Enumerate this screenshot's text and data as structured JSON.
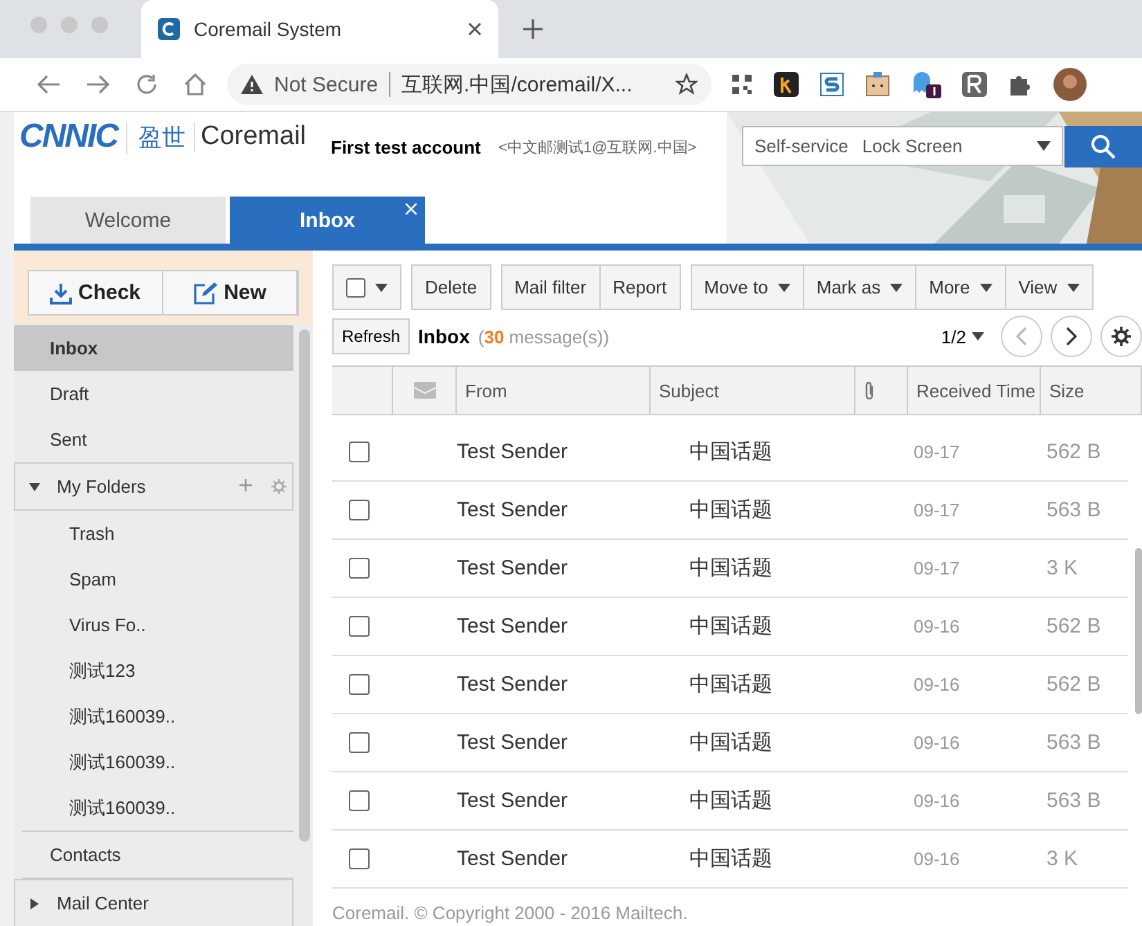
{
  "browser": {
    "tab_title": "Coremail System",
    "security": "Not Secure",
    "url": "互联网.中国/coremail/X..."
  },
  "header": {
    "logo": "CNNIC",
    "brand_cn": "盈世",
    "brand": "Coremail",
    "account_name": "First test account",
    "account_email": "<中文邮测试1@互联网.中国>",
    "links": [
      "Self-service",
      "Lock Screen"
    ]
  },
  "tabs": [
    {
      "label": "Welcome",
      "selected": false,
      "closable": false
    },
    {
      "label": "Inbox",
      "selected": true,
      "closable": true
    }
  ],
  "actions": [
    {
      "label": "Check",
      "kind": "check"
    },
    {
      "label": "New",
      "kind": "new"
    }
  ],
  "sidebar": {
    "items": [
      {
        "label": "Inbox",
        "selected": true
      },
      {
        "label": "Draft",
        "selected": false
      },
      {
        "label": "Sent",
        "selected": false
      },
      {
        "label": "My Folders",
        "kind": "group",
        "selected": false,
        "expanded": true,
        "children": [
          {
            "label": "Trash",
            "selected": false
          },
          {
            "label": "Spam",
            "selected": false
          },
          {
            "label": "Virus Fo..",
            "selected": false
          },
          {
            "label": "测试123",
            "selected": false
          },
          {
            "label": "测试160039..",
            "selected": false
          },
          {
            "label": "测试160039..",
            "selected": false
          },
          {
            "label": "测试160039..",
            "selected": false
          }
        ]
      },
      {
        "label": "Contacts",
        "selected": false
      },
      {
        "label": "Mail Center",
        "kind": "group",
        "selected": false,
        "expanded": false
      }
    ]
  },
  "toolbar": {
    "select_all_checked": false,
    "groups": [
      [
        {
          "label": "Delete",
          "dropdown": false
        }
      ],
      [
        {
          "label": "Mail filter",
          "dropdown": false
        },
        {
          "label": "Report",
          "dropdown": false
        }
      ],
      [
        {
          "label": "Move to",
          "dropdown": true
        },
        {
          "label": "Mark as",
          "dropdown": true
        },
        {
          "label": "More",
          "dropdown": true
        },
        {
          "label": "View",
          "dropdown": true
        }
      ]
    ],
    "refresh": "Refresh"
  },
  "list": {
    "title": "Inbox",
    "open": "(",
    "count": "30",
    "unit": "message(s))",
    "page": "1/2"
  },
  "columns": [
    {
      "kind": "check"
    },
    {
      "kind": "read"
    },
    {
      "kind": "text",
      "label": "From"
    },
    {
      "kind": "text",
      "label": "Subject"
    },
    {
      "kind": "attach"
    },
    {
      "kind": "text",
      "label": "Received Time"
    },
    {
      "kind": "text",
      "label": "Size"
    }
  ],
  "rows": [
    {
      "checked": false,
      "from": "Test Sender",
      "subject": "中国话题",
      "date": "09-17",
      "size": "562 B"
    },
    {
      "checked": false,
      "from": "Test Sender",
      "subject": "中国话题",
      "date": "09-17",
      "size": "563 B"
    },
    {
      "checked": false,
      "from": "Test Sender",
      "subject": "中国话题",
      "date": "09-17",
      "size": "3 K"
    },
    {
      "checked": false,
      "from": "Test Sender",
      "subject": "中国话题",
      "date": "09-16",
      "size": "562 B"
    },
    {
      "checked": false,
      "from": "Test Sender",
      "subject": "中国话题",
      "date": "09-16",
      "size": "562 B"
    },
    {
      "checked": false,
      "from": "Test Sender",
      "subject": "中国话题",
      "date": "09-16",
      "size": "563 B"
    },
    {
      "checked": false,
      "from": "Test Sender",
      "subject": "中国话题",
      "date": "09-16",
      "size": "563 B"
    },
    {
      "checked": false,
      "from": "Test Sender",
      "subject": "中国话题",
      "date": "09-16",
      "size": "3 K"
    }
  ],
  "footer": "Coremail. © Copyright 2000 - 2016 Mailtech."
}
